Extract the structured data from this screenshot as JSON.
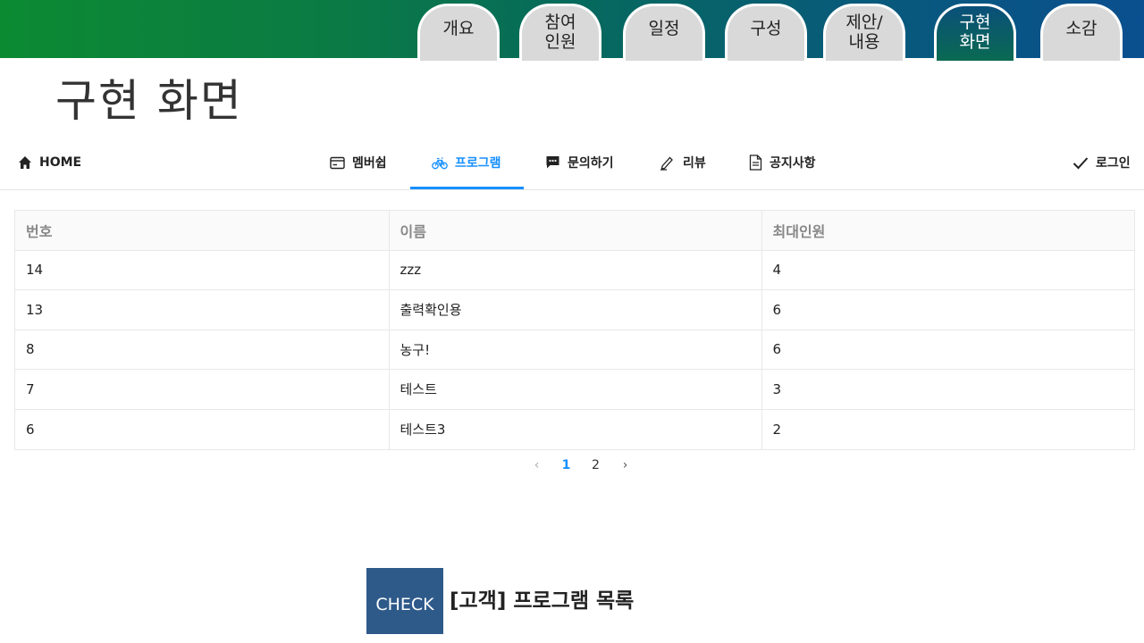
{
  "slide_tabs": [
    {
      "label": "개요",
      "active": false
    },
    {
      "label": "참여\n인원",
      "active": false
    },
    {
      "label": "일정",
      "active": false
    },
    {
      "label": "구성",
      "active": false
    },
    {
      "label": "제안/\n내용",
      "active": false
    },
    {
      "label": "구현\n화면",
      "active": true
    },
    {
      "label": "소감",
      "active": false
    }
  ],
  "page_title": "구현 화면",
  "nav": {
    "home": "HOME",
    "items": [
      {
        "label": "멤버쉽",
        "icon": "card-icon"
      },
      {
        "label": "프로그램",
        "icon": "bicycle-icon",
        "active": true
      },
      {
        "label": "문의하기",
        "icon": "message-icon"
      },
      {
        "label": "리뷰",
        "icon": "pencil-icon"
      },
      {
        "label": "공지사항",
        "icon": "document-icon"
      }
    ],
    "login": "로그인"
  },
  "table": {
    "headers": [
      "번호",
      "이름",
      "최대인원"
    ],
    "rows": [
      [
        "14",
        "zzz",
        "4"
      ],
      [
        "13",
        "출력확인용",
        "6"
      ],
      [
        "8",
        "농구!",
        "6"
      ],
      [
        "7",
        "테스트",
        "3"
      ],
      [
        "6",
        "테스트3",
        "2"
      ]
    ]
  },
  "pagination": {
    "pages": [
      "1",
      "2"
    ],
    "current": "1",
    "prev": "‹",
    "next": "›"
  },
  "check": {
    "badge": "CHECK",
    "text": "[고객] 프로그램 목록"
  },
  "colors": {
    "accent": "#1890ff",
    "check_bg": "#2e5a8a",
    "banner_start": "#0c8a32",
    "banner_end": "#0a4f8f"
  }
}
